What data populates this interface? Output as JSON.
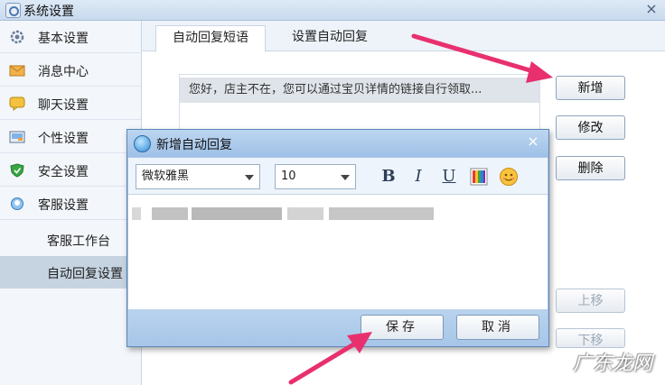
{
  "window": {
    "title": "系统设置"
  },
  "sidebar": {
    "items": [
      {
        "label": "基本设置",
        "icon": "gear-icon"
      },
      {
        "label": "消息中心",
        "icon": "envelope-icon"
      },
      {
        "label": "聊天设置",
        "icon": "chat-bubble-icon"
      },
      {
        "label": "个性设置",
        "icon": "picture-frame-icon"
      },
      {
        "label": "安全设置",
        "icon": "shield-icon"
      },
      {
        "label": "客服设置",
        "icon": "headset-icon"
      }
    ],
    "sub_items": [
      {
        "label": "客服工作台"
      },
      {
        "label": "自动回复设置"
      }
    ]
  },
  "tabs": [
    {
      "label": "自动回复短语"
    },
    {
      "label": "设置自动回复"
    }
  ],
  "phrase_list": [
    "您好，店主不在，您可以通过宝贝详情的链接自行领取..."
  ],
  "right_buttons": {
    "add": "新增",
    "edit": "修改",
    "delete": "删除",
    "move_up": "上移",
    "move_down": "下移"
  },
  "dialog": {
    "title": "新增自动回复",
    "font_name": "微软雅黑",
    "font_size": "10",
    "bold": "B",
    "italic": "I",
    "underline": "U",
    "save": "保存",
    "cancel": "取消"
  },
  "watermark": "广东龙网",
  "colors": {
    "arrow": "#e8306f",
    "dialog_frame": "#a9c8ea",
    "selected_row": "#dfe4ea"
  }
}
